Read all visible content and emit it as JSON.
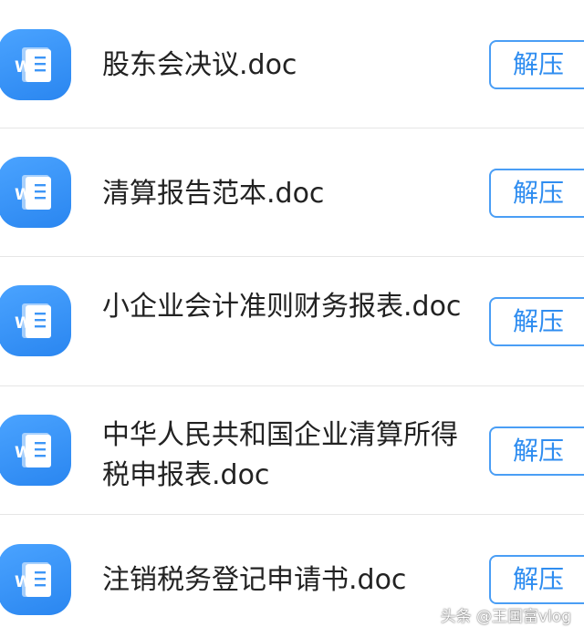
{
  "files": [
    {
      "name": "股东会决议.doc",
      "action": "解压",
      "icon": "word-document-icon",
      "icon_letter": "W"
    },
    {
      "name": "清算报告范本.doc",
      "action": "解压",
      "icon": "word-document-icon",
      "icon_letter": "W"
    },
    {
      "name": "小企业会计准则财务报表.doc",
      "action": "解压",
      "icon": "word-document-icon",
      "icon_letter": "W"
    },
    {
      "name": "中华人民共和国企业清算所得税申报表.doc",
      "action": "解压",
      "icon": "word-document-icon",
      "icon_letter": "W"
    },
    {
      "name": "注销税务登记申请书.doc",
      "action": "解压",
      "icon": "word-document-icon",
      "icon_letter": "W"
    }
  ],
  "watermark": "头条 @王国富vlog",
  "colors": {
    "accent": "#2f8df0",
    "icon_background": "#3d96f7",
    "text": "#222222",
    "divider": "#e6e6e6"
  }
}
